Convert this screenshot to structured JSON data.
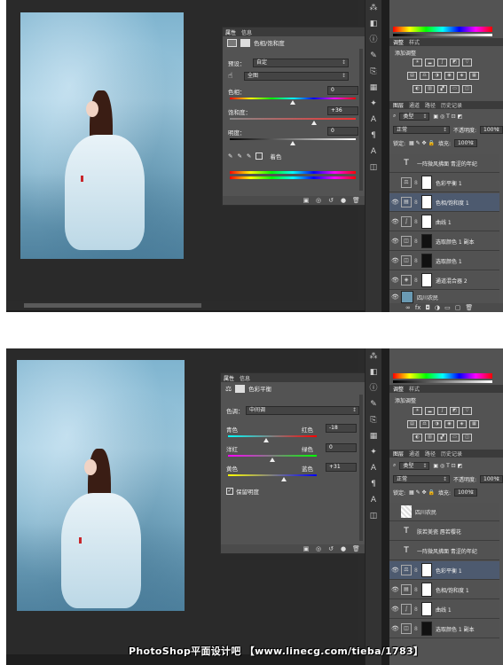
{
  "screen1": {
    "properties": {
      "tabs": [
        "属性",
        "信息"
      ],
      "title": "色相/饱和度",
      "preset_label": "预设：",
      "preset_value": "自定",
      "channel_value": "全图",
      "hue_label": "色相：",
      "hue_value": "0",
      "saturation_label": "饱和度：",
      "saturation_value": "+36",
      "lightness_label": "明度：",
      "lightness_value": "0",
      "colorize_label": "着色"
    },
    "adjustments": {
      "tabs": [
        "调整",
        "样式"
      ],
      "add_label": "添加调整"
    },
    "layers_tabs": [
      "图层",
      "通道",
      "路径",
      "历史记录"
    ],
    "kind_label": "类型",
    "blend_mode": "正常",
    "opacity_label": "不透明度:",
    "opacity_value": "100%",
    "lock_label": "锁定:",
    "fill_label": "填充:",
    "fill_value": "100%",
    "layers": [
      {
        "name": "一阵微风拂面 青涩的年纪",
        "type": "text"
      },
      {
        "name": "色彩平衡 1",
        "type": "balance"
      },
      {
        "name": "色相/饱和度 1",
        "type": "huesat"
      },
      {
        "name": "曲线 1",
        "type": "curves"
      },
      {
        "name": "选取颜色 1 副本",
        "type": "selective"
      },
      {
        "name": "选取颜色 1",
        "type": "selective"
      },
      {
        "name": "通道混合器 2",
        "type": "mixer"
      },
      {
        "name": "四川农民",
        "type": "image"
      }
    ]
  },
  "screen2": {
    "properties": {
      "tabs": [
        "属性",
        "信息"
      ],
      "title": "色彩平衡",
      "tone_label": "色调：",
      "tone_value": "中间调",
      "cyan_label": "青色",
      "red_label": "红色",
      "cyan_red_value": "-18",
      "magenta_label": "洋红",
      "green_label": "绿色",
      "magenta_green_value": "0",
      "yellow_label": "黄色",
      "blue_label": "蓝色",
      "yellow_blue_value": "+31",
      "preserve_label": "保留明度"
    },
    "adjustments": {
      "tabs": [
        "调整",
        "样式"
      ],
      "add_label": "添加调整"
    },
    "layers_tabs": [
      "图层",
      "通道",
      "路径",
      "历史记录"
    ],
    "kind_label": "类型",
    "blend_mode": "正常",
    "opacity_label": "不透明度:",
    "opacity_value": "100%",
    "lock_label": "锁定:",
    "fill_label": "填充:",
    "fill_value": "100%",
    "layers": [
      {
        "name": "四川农民",
        "type": "image"
      },
      {
        "name": "肤若美瓷 唇若樱花",
        "type": "text"
      },
      {
        "name": "一阵微风拂面 青涩的年纪",
        "type": "text"
      },
      {
        "name": "色彩平衡 1",
        "type": "balance"
      },
      {
        "name": "色相/饱和度 1",
        "type": "huesat"
      },
      {
        "name": "曲线 1",
        "type": "curves"
      },
      {
        "name": "选取颜色 1 副本",
        "type": "selective"
      }
    ]
  },
  "watermark": "PhotoShop平面设计吧 【www.linecg.com/tieba/1783】",
  "colors": {
    "panel": "#535353",
    "workspace": "#1e1e1e",
    "selected_layer": "#4d5a6f"
  }
}
